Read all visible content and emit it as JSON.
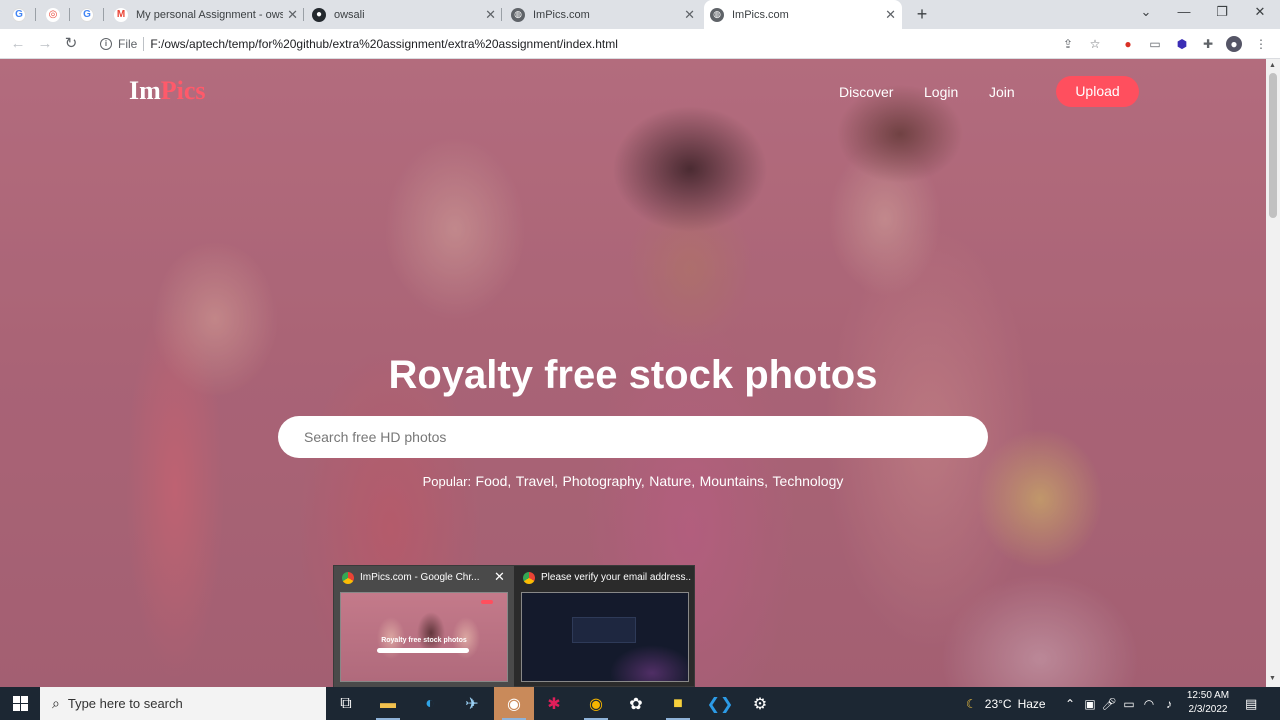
{
  "browser": {
    "tabs": [
      {
        "title": "",
        "favicon": "G",
        "favicon_kind": "google"
      },
      {
        "title": "",
        "favicon": "◎",
        "favicon_kind": "ring"
      },
      {
        "title": "",
        "favicon": "G",
        "favicon_kind": "google"
      },
      {
        "title": "My personal Assignment - owsali",
        "favicon": "M",
        "favicon_kind": "gmail"
      },
      {
        "title": "owsali",
        "favicon": "●",
        "favicon_kind": "github"
      },
      {
        "title": "ImPics.com",
        "favicon": "◍",
        "favicon_kind": "globe"
      },
      {
        "title": "ImPics.com",
        "favicon": "◍",
        "favicon_kind": "globe",
        "active": true
      }
    ],
    "new_tab": "+",
    "window_controls": {
      "chevron": "⌄",
      "minimize": "—",
      "restore": "❐",
      "close": "✕"
    },
    "address": {
      "scheme_label": "File",
      "url": "F:/ows/aptech/temp/for%20github/extra%20assignment/extra%20assignment/index.html"
    }
  },
  "site": {
    "logo_main": "Im",
    "logo_accent": "Pics",
    "nav": {
      "discover": "Discover",
      "login": "Login",
      "join": "Join",
      "upload": "Upload"
    },
    "hero_title": "Royalty free stock photos",
    "search_placeholder": "Search free HD photos",
    "popular_label": "Popular:",
    "popular_tags": [
      "Food,",
      "Travel,",
      "Photography,",
      "Nature,",
      "Mountains,",
      "Technology"
    ],
    "accent_color": "#ff4f5e"
  },
  "thumbnails": [
    {
      "title": "ImPics.com - Google Chr...",
      "preview_title": "Royalty free stock photos"
    },
    {
      "title": "Please verify your email address..."
    }
  ],
  "taskbar": {
    "search_placeholder": "Type here to search",
    "weather": {
      "temp": "23°C",
      "condition": "Haze"
    },
    "time": "12:50 AM",
    "date": "2/3/2022"
  }
}
